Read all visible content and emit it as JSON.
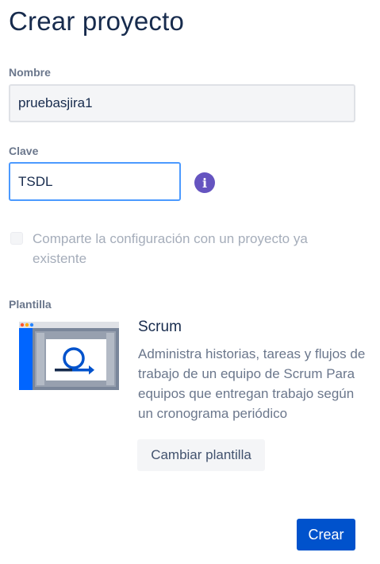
{
  "page": {
    "title": "Crear proyecto"
  },
  "form": {
    "name_label": "Nombre",
    "name_value": "pruebasjira1",
    "key_label": "Clave",
    "key_value": "TSDL",
    "info_icon": "info-icon",
    "share_checked": false,
    "share_label": "Comparte la configuración con un proyecto ya existente"
  },
  "template": {
    "section_label": "Plantilla",
    "name": "Scrum",
    "description": "Administra historias, tareas y flujos de trabajo de un equipo de Scrum Para equipos que entregan trabajo según un cronograma periódico",
    "change_label": "Cambiar plantilla"
  },
  "actions": {
    "create_label": "Crear"
  },
  "colors": {
    "primary": "#0052cc",
    "focus_border": "#4c9aff",
    "info": "#6554c0",
    "heading": "#172b4d",
    "subtle": "#6b778c"
  }
}
